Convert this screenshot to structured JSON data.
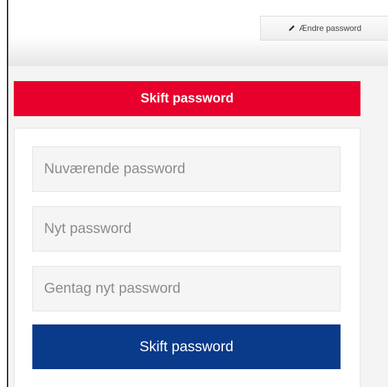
{
  "toolbar": {
    "edit_password_label": "Ændre password",
    "edit_icon": "pencil-icon"
  },
  "panel": {
    "title": "Skift password",
    "fields": [
      {
        "placeholder": "Nuværende password",
        "value": ""
      },
      {
        "placeholder": "Nyt password",
        "value": ""
      },
      {
        "placeholder": "Gentag nyt password",
        "value": ""
      }
    ],
    "submit_label": "Skift password"
  },
  "colors": {
    "header_red": "#e8002d",
    "submit_blue": "#0a3a8a"
  }
}
